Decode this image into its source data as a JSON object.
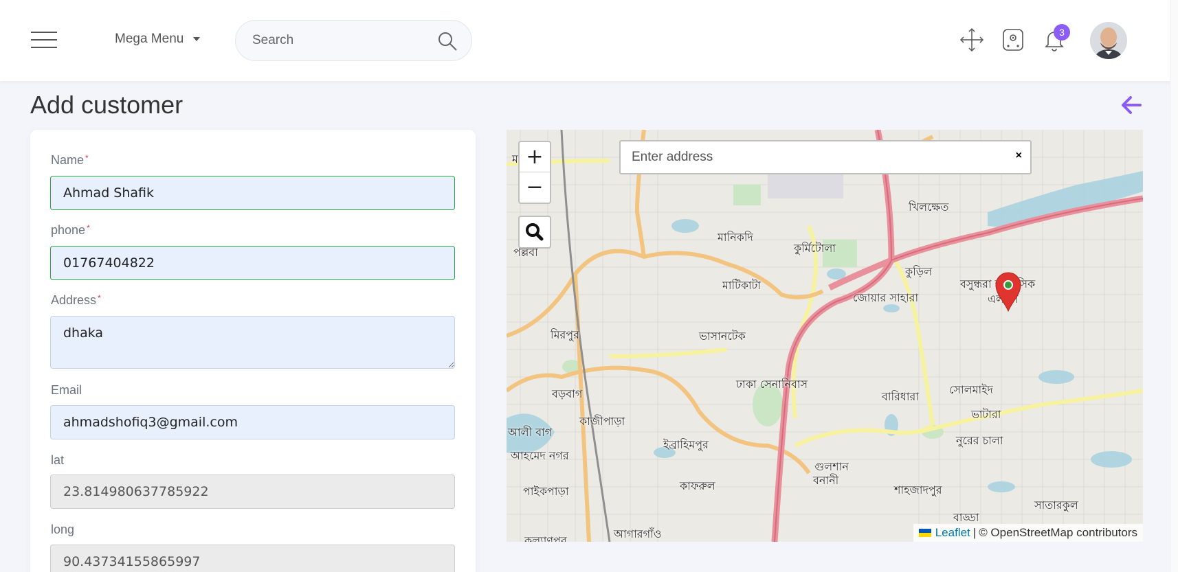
{
  "header": {
    "mega_menu_label": "Mega Menu",
    "search_placeholder": "Search",
    "notification_count": "3",
    "accent_color": "#8b5cf6"
  },
  "page": {
    "title": "Add customer"
  },
  "form": {
    "name": {
      "label": "Name",
      "required_mark": "*",
      "value": "Ahmad Shafik"
    },
    "phone": {
      "label": "phone",
      "required_mark": "*",
      "value": "01767404822"
    },
    "address": {
      "label": "Address",
      "required_mark": "*",
      "value": "dhaka"
    },
    "email": {
      "label": "Email",
      "value": "ahmadshofiq3@gmail.com"
    },
    "lat": {
      "label": "lat",
      "value": "23.814980637785922"
    },
    "long": {
      "label": "long",
      "value": "90.43734155865997"
    }
  },
  "map": {
    "zoom_in": "+",
    "zoom_out": "−",
    "address_placeholder": "Enter address",
    "clear_symbol": "×",
    "attribution_leaflet": "Leaflet",
    "attribution_separator": "|",
    "attribution_osm": "© OpenStreetMap contributors",
    "labels": {
      "l1": "মানিবাস",
      "l2": "খিলক্ষেত",
      "l3": "মানিকদি",
      "l4": "কুর্মিটোলা",
      "l5": "কুড়িল",
      "l6": "মাটিকাটা",
      "l7": "জোয়ার সাহারা",
      "l8": "বসুন্ধরা আবাসিক",
      "l9": "এলাকা",
      "l10": "মিরপুর",
      "l11": "ভাসানটেক",
      "l12": "বড়বাগ",
      "l13": "ঢাকা সেনানিবাস",
      "l14": "বারিধারা",
      "l15": "সোলমাইদ",
      "l16": "কাজীপাড়া",
      "l17": "ভাটারা",
      "l18": "আলী বাগ",
      "l19": "আহমেদ নগর",
      "l20": "ইব্রাহিমপুর",
      "l21": "নুরের চালা",
      "l22": "গুলশান",
      "l23": "বনানী",
      "l24": "কাফরুল",
      "l25": "শাহজাদপুর",
      "l26": "পাইকপাড়া",
      "l27": "সাতারকুল",
      "l28": "বাড্ডা",
      "l29": "আগারগাঁও",
      "l30": "কল্যাণপুর",
      "l31": "পল্লবী"
    }
  }
}
